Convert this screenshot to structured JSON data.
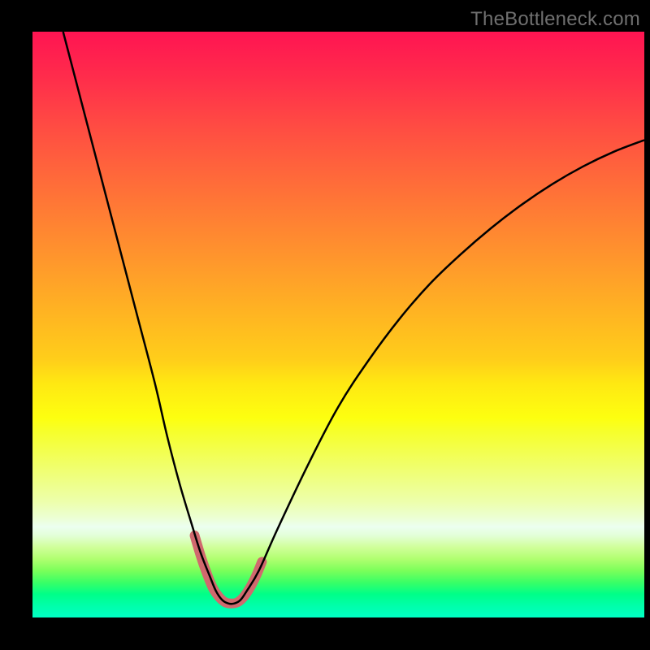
{
  "attribution": "TheBottleneck.com",
  "chart_data": {
    "type": "line",
    "title": "",
    "xlabel": "",
    "ylabel": "",
    "xlim": [
      0,
      100
    ],
    "ylim": [
      0,
      100
    ],
    "grid": false,
    "series": [
      {
        "name": "bottleneck-curve",
        "color": "#000000",
        "stroke_width": 2.5,
        "x": [
          5,
          8,
          11,
          14,
          17,
          20,
          22,
          24,
          26,
          27.5,
          29,
          30,
          31,
          32,
          33,
          34,
          35,
          37,
          40,
          45,
          50,
          55,
          60,
          65,
          70,
          75,
          80,
          85,
          90,
          95,
          100
        ],
        "y": [
          100,
          88,
          76,
          64,
          52,
          40,
          31,
          23,
          16,
          11,
          7,
          4.5,
          3,
          2.4,
          2.4,
          3,
          4.5,
          8,
          15,
          26,
          36,
          44,
          51,
          57,
          62,
          66.5,
          70.5,
          74,
          77,
          79.5,
          81.5
        ]
      },
      {
        "name": "highlight-valley",
        "color": "#d0696e",
        "stroke_width": 12,
        "linecap": "round",
        "x": [
          26.5,
          27.5,
          28.5,
          29.5,
          30.5,
          31.5,
          32.5,
          33.5,
          34.5,
          35.5,
          36.5,
          37.5
        ],
        "y": [
          14,
          10.5,
          7.5,
          5,
          3.5,
          2.6,
          2.4,
          2.6,
          3.5,
          5,
          7,
          9.5
        ]
      }
    ]
  }
}
